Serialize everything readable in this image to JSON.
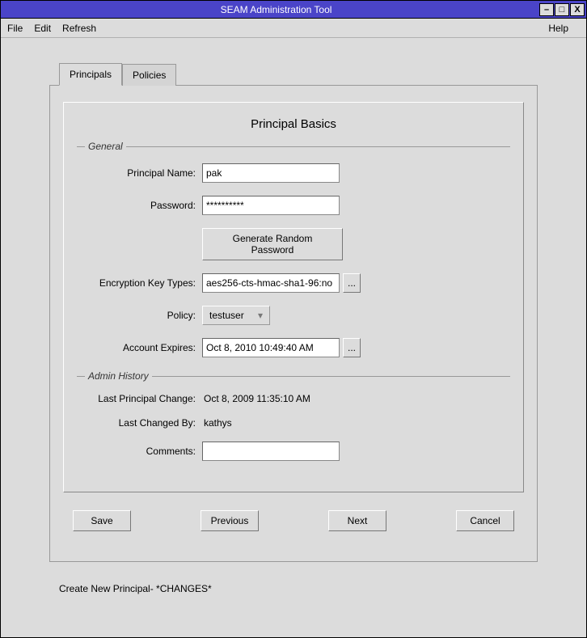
{
  "window": {
    "title": "SEAM Administration Tool"
  },
  "menu": {
    "file": "File",
    "edit": "Edit",
    "refresh": "Refresh",
    "help": "Help"
  },
  "tabs": {
    "principals": "Principals",
    "policies": "Policies"
  },
  "panel": {
    "title": "Principal Basics"
  },
  "sections": {
    "general": "General",
    "admin_history": "Admin History"
  },
  "labels": {
    "principal_name": "Principal Name:",
    "password": "Password:",
    "generate_random": "Generate Random Password",
    "encryption_key_types": "Encryption Key Types:",
    "policy": "Policy:",
    "account_expires": "Account Expires:",
    "last_principal_change": "Last Principal Change:",
    "last_changed_by": "Last Changed By:",
    "comments": "Comments:"
  },
  "values": {
    "principal_name": "pak",
    "password": "**********",
    "encryption_key_types": "aes256-cts-hmac-sha1-96:no",
    "policy": "testuser",
    "account_expires": "Oct 8, 2010 10:49:40 AM",
    "last_principal_change": "Oct 8, 2009 11:35:10 AM",
    "last_changed_by": "kathys",
    "comments": ""
  },
  "buttons": {
    "ellipsis": "...",
    "save": "Save",
    "previous": "Previous",
    "next": "Next",
    "cancel": "Cancel"
  },
  "status": "Create New Principal- *CHANGES*",
  "icons": {
    "minimize": "–",
    "maximize": "□",
    "close": "X",
    "dropdown": "▾"
  }
}
